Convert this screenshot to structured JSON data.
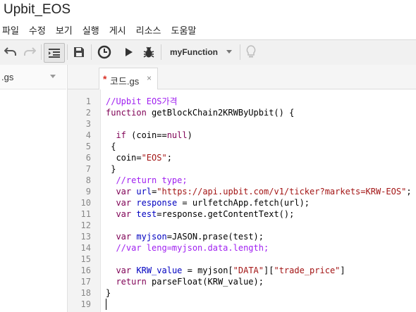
{
  "app": {
    "title": "Upbit_EOS"
  },
  "menu": [
    "파일",
    "수정",
    "보기",
    "실행",
    "게시",
    "리소스",
    "도움말"
  ],
  "toolbar": {
    "function_select": "myFunction"
  },
  "sidebar": {
    "file_name": ".gs"
  },
  "tab": {
    "modified_mark": "*",
    "name": "코드.gs",
    "close_symbol": "×"
  },
  "editor": {
    "line_numbers": [
      "1",
      "2",
      "3",
      "4",
      "5",
      "6",
      "7",
      "8",
      "9",
      "10",
      "11",
      "12",
      "13",
      "14",
      "15",
      "16",
      "17",
      "18",
      "19"
    ],
    "lines": [
      [
        {
          "t": "//Upbit EOS가격",
          "c": "comment"
        }
      ],
      [
        {
          "t": "function",
          "c": "keyword"
        },
        {
          "t": " getBlockChain2KRWByUpbit() {",
          "c": "plain"
        }
      ],
      [],
      [
        {
          "t": "  ",
          "c": "plain"
        },
        {
          "t": "if",
          "c": "keyword"
        },
        {
          "t": " (coin==",
          "c": "plain"
        },
        {
          "t": "null",
          "c": "keyword"
        },
        {
          "t": ")",
          "c": "plain"
        }
      ],
      [
        {
          "t": " {",
          "c": "plain"
        }
      ],
      [
        {
          "t": "  coin=",
          "c": "plain"
        },
        {
          "t": "\"EOS\"",
          "c": "str"
        },
        {
          "t": ";",
          "c": "plain"
        }
      ],
      [
        {
          "t": " }",
          "c": "plain"
        }
      ],
      [
        {
          "t": "  ",
          "c": "plain"
        },
        {
          "t": "//return type;",
          "c": "comment"
        }
      ],
      [
        {
          "t": "  ",
          "c": "plain"
        },
        {
          "t": "var",
          "c": "keyword"
        },
        {
          "t": " ",
          "c": "plain"
        },
        {
          "t": "url",
          "c": "var"
        },
        {
          "t": "=",
          "c": "plain"
        },
        {
          "t": "\"https://api.upbit.com/v1/ticker?markets=KRW-EOS\"",
          "c": "str"
        },
        {
          "t": ";",
          "c": "plain"
        }
      ],
      [
        {
          "t": "  ",
          "c": "plain"
        },
        {
          "t": "var",
          "c": "keyword"
        },
        {
          "t": " ",
          "c": "plain"
        },
        {
          "t": "response",
          "c": "var"
        },
        {
          "t": " = urlfetchApp.fetch(url);",
          "c": "plain"
        }
      ],
      [
        {
          "t": "  ",
          "c": "plain"
        },
        {
          "t": "var",
          "c": "keyword"
        },
        {
          "t": " ",
          "c": "plain"
        },
        {
          "t": "test",
          "c": "var"
        },
        {
          "t": "=response.getContentText();",
          "c": "plain"
        }
      ],
      [],
      [
        {
          "t": "  ",
          "c": "plain"
        },
        {
          "t": "var",
          "c": "keyword"
        },
        {
          "t": " ",
          "c": "plain"
        },
        {
          "t": "myjson",
          "c": "var"
        },
        {
          "t": "=JASON.prase(test);",
          "c": "plain"
        }
      ],
      [
        {
          "t": "  ",
          "c": "plain"
        },
        {
          "t": "//var leng=myjson.data.length;",
          "c": "comment"
        }
      ],
      [],
      [
        {
          "t": "  ",
          "c": "plain"
        },
        {
          "t": "var",
          "c": "keyword"
        },
        {
          "t": " ",
          "c": "plain"
        },
        {
          "t": "KRW_value",
          "c": "var"
        },
        {
          "t": " = myjson[",
          "c": "plain"
        },
        {
          "t": "\"DATA\"",
          "c": "str"
        },
        {
          "t": "][",
          "c": "plain"
        },
        {
          "t": "\"trade_price\"",
          "c": "str"
        },
        {
          "t": "]",
          "c": "plain"
        }
      ],
      [
        {
          "t": "  ",
          "c": "plain"
        },
        {
          "t": "return",
          "c": "keyword"
        },
        {
          "t": " parseFloat(KRW_value);",
          "c": "plain"
        }
      ],
      [
        {
          "t": "}",
          "c": "plain"
        }
      ],
      []
    ]
  },
  "colors": {
    "comment": "#a020f0",
    "keyword": "#7f0055",
    "variable": "#0000c0",
    "string": "#a31515",
    "modified_mark": "#d93025",
    "toolbar_bg": "#f1f1f1",
    "gutter_bg": "#f3f3f3"
  },
  "icons": {
    "undo": "undo-icon",
    "redo": "redo-icon",
    "indent": "indent-icon",
    "save": "save-icon",
    "triggers": "clock-icon",
    "run": "play-icon",
    "debug": "bug-icon",
    "execution_hints": "lightbulb-icon"
  }
}
